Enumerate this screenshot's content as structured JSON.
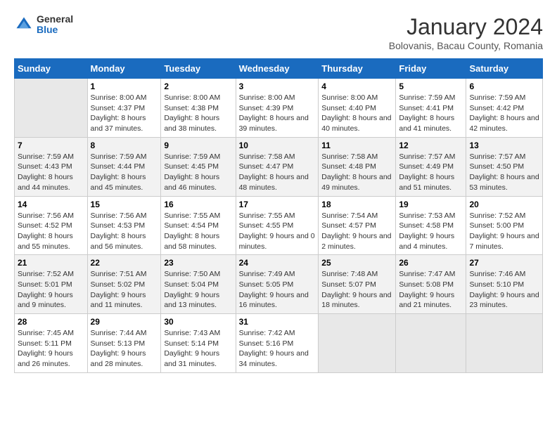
{
  "logo": {
    "general": "General",
    "blue": "Blue"
  },
  "title": "January 2024",
  "subtitle": "Bolovanis, Bacau County, Romania",
  "days_of_week": [
    "Sunday",
    "Monday",
    "Tuesday",
    "Wednesday",
    "Thursday",
    "Friday",
    "Saturday"
  ],
  "weeks": [
    [
      {
        "num": "",
        "sunrise": "",
        "sunset": "",
        "daylight": ""
      },
      {
        "num": "1",
        "sunrise": "Sunrise: 8:00 AM",
        "sunset": "Sunset: 4:37 PM",
        "daylight": "Daylight: 8 hours and 37 minutes."
      },
      {
        "num": "2",
        "sunrise": "Sunrise: 8:00 AM",
        "sunset": "Sunset: 4:38 PM",
        "daylight": "Daylight: 8 hours and 38 minutes."
      },
      {
        "num": "3",
        "sunrise": "Sunrise: 8:00 AM",
        "sunset": "Sunset: 4:39 PM",
        "daylight": "Daylight: 8 hours and 39 minutes."
      },
      {
        "num": "4",
        "sunrise": "Sunrise: 8:00 AM",
        "sunset": "Sunset: 4:40 PM",
        "daylight": "Daylight: 8 hours and 40 minutes."
      },
      {
        "num": "5",
        "sunrise": "Sunrise: 7:59 AM",
        "sunset": "Sunset: 4:41 PM",
        "daylight": "Daylight: 8 hours and 41 minutes."
      },
      {
        "num": "6",
        "sunrise": "Sunrise: 7:59 AM",
        "sunset": "Sunset: 4:42 PM",
        "daylight": "Daylight: 8 hours and 42 minutes."
      }
    ],
    [
      {
        "num": "7",
        "sunrise": "Sunrise: 7:59 AM",
        "sunset": "Sunset: 4:43 PM",
        "daylight": "Daylight: 8 hours and 44 minutes."
      },
      {
        "num": "8",
        "sunrise": "Sunrise: 7:59 AM",
        "sunset": "Sunset: 4:44 PM",
        "daylight": "Daylight: 8 hours and 45 minutes."
      },
      {
        "num": "9",
        "sunrise": "Sunrise: 7:59 AM",
        "sunset": "Sunset: 4:45 PM",
        "daylight": "Daylight: 8 hours and 46 minutes."
      },
      {
        "num": "10",
        "sunrise": "Sunrise: 7:58 AM",
        "sunset": "Sunset: 4:47 PM",
        "daylight": "Daylight: 8 hours and 48 minutes."
      },
      {
        "num": "11",
        "sunrise": "Sunrise: 7:58 AM",
        "sunset": "Sunset: 4:48 PM",
        "daylight": "Daylight: 8 hours and 49 minutes."
      },
      {
        "num": "12",
        "sunrise": "Sunrise: 7:57 AM",
        "sunset": "Sunset: 4:49 PM",
        "daylight": "Daylight: 8 hours and 51 minutes."
      },
      {
        "num": "13",
        "sunrise": "Sunrise: 7:57 AM",
        "sunset": "Sunset: 4:50 PM",
        "daylight": "Daylight: 8 hours and 53 minutes."
      }
    ],
    [
      {
        "num": "14",
        "sunrise": "Sunrise: 7:56 AM",
        "sunset": "Sunset: 4:52 PM",
        "daylight": "Daylight: 8 hours and 55 minutes."
      },
      {
        "num": "15",
        "sunrise": "Sunrise: 7:56 AM",
        "sunset": "Sunset: 4:53 PM",
        "daylight": "Daylight: 8 hours and 56 minutes."
      },
      {
        "num": "16",
        "sunrise": "Sunrise: 7:55 AM",
        "sunset": "Sunset: 4:54 PM",
        "daylight": "Daylight: 8 hours and 58 minutes."
      },
      {
        "num": "17",
        "sunrise": "Sunrise: 7:55 AM",
        "sunset": "Sunset: 4:55 PM",
        "daylight": "Daylight: 9 hours and 0 minutes."
      },
      {
        "num": "18",
        "sunrise": "Sunrise: 7:54 AM",
        "sunset": "Sunset: 4:57 PM",
        "daylight": "Daylight: 9 hours and 2 minutes."
      },
      {
        "num": "19",
        "sunrise": "Sunrise: 7:53 AM",
        "sunset": "Sunset: 4:58 PM",
        "daylight": "Daylight: 9 hours and 4 minutes."
      },
      {
        "num": "20",
        "sunrise": "Sunrise: 7:52 AM",
        "sunset": "Sunset: 5:00 PM",
        "daylight": "Daylight: 9 hours and 7 minutes."
      }
    ],
    [
      {
        "num": "21",
        "sunrise": "Sunrise: 7:52 AM",
        "sunset": "Sunset: 5:01 PM",
        "daylight": "Daylight: 9 hours and 9 minutes."
      },
      {
        "num": "22",
        "sunrise": "Sunrise: 7:51 AM",
        "sunset": "Sunset: 5:02 PM",
        "daylight": "Daylight: 9 hours and 11 minutes."
      },
      {
        "num": "23",
        "sunrise": "Sunrise: 7:50 AM",
        "sunset": "Sunset: 5:04 PM",
        "daylight": "Daylight: 9 hours and 13 minutes."
      },
      {
        "num": "24",
        "sunrise": "Sunrise: 7:49 AM",
        "sunset": "Sunset: 5:05 PM",
        "daylight": "Daylight: 9 hours and 16 minutes."
      },
      {
        "num": "25",
        "sunrise": "Sunrise: 7:48 AM",
        "sunset": "Sunset: 5:07 PM",
        "daylight": "Daylight: 9 hours and 18 minutes."
      },
      {
        "num": "26",
        "sunrise": "Sunrise: 7:47 AM",
        "sunset": "Sunset: 5:08 PM",
        "daylight": "Daylight: 9 hours and 21 minutes."
      },
      {
        "num": "27",
        "sunrise": "Sunrise: 7:46 AM",
        "sunset": "Sunset: 5:10 PM",
        "daylight": "Daylight: 9 hours and 23 minutes."
      }
    ],
    [
      {
        "num": "28",
        "sunrise": "Sunrise: 7:45 AM",
        "sunset": "Sunset: 5:11 PM",
        "daylight": "Daylight: 9 hours and 26 minutes."
      },
      {
        "num": "29",
        "sunrise": "Sunrise: 7:44 AM",
        "sunset": "Sunset: 5:13 PM",
        "daylight": "Daylight: 9 hours and 28 minutes."
      },
      {
        "num": "30",
        "sunrise": "Sunrise: 7:43 AM",
        "sunset": "Sunset: 5:14 PM",
        "daylight": "Daylight: 9 hours and 31 minutes."
      },
      {
        "num": "31",
        "sunrise": "Sunrise: 7:42 AM",
        "sunset": "Sunset: 5:16 PM",
        "daylight": "Daylight: 9 hours and 34 minutes."
      },
      {
        "num": "",
        "sunrise": "",
        "sunset": "",
        "daylight": ""
      },
      {
        "num": "",
        "sunrise": "",
        "sunset": "",
        "daylight": ""
      },
      {
        "num": "",
        "sunrise": "",
        "sunset": "",
        "daylight": ""
      }
    ]
  ]
}
